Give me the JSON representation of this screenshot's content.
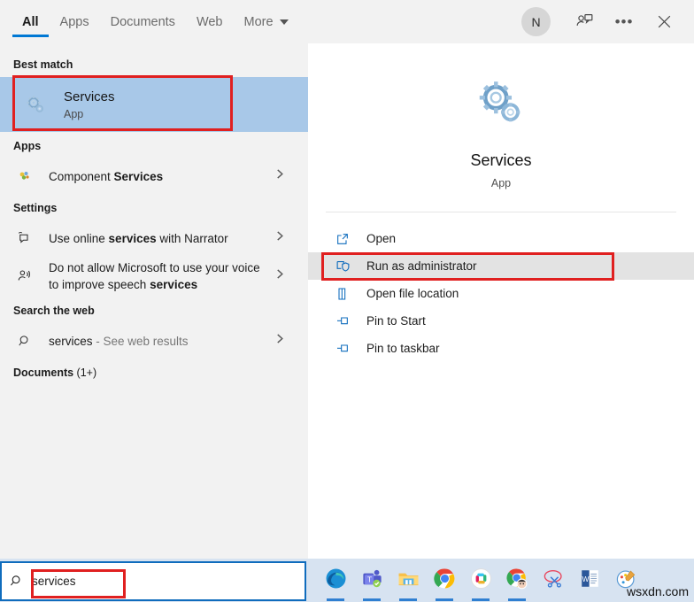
{
  "tabs": [
    {
      "label": "All",
      "active": true
    },
    {
      "label": "Apps",
      "active": false
    },
    {
      "label": "Documents",
      "active": false
    },
    {
      "label": "Web",
      "active": false
    },
    {
      "label": "More",
      "active": false,
      "caret": true
    }
  ],
  "header": {
    "avatar_initial": "N",
    "feedback_icon": "person-feedback-icon",
    "more_icon": "ellipsis-icon",
    "close_icon": "close-icon"
  },
  "left": {
    "best_match_header": "Best match",
    "best_match": {
      "title": "Services",
      "subtitle": "App",
      "icon": "services-gears-icon"
    },
    "apps_header": "Apps",
    "apps": [
      {
        "prefix": "Component ",
        "bold": "Services",
        "suffix": "",
        "icon": "component-services-icon"
      }
    ],
    "settings_header": "Settings",
    "settings": [
      {
        "prefix": "Use online ",
        "bold": "services",
        "suffix": " with Narrator",
        "icon": "narrator-icon"
      },
      {
        "prefix": "Do not allow Microsoft to use your voice to improve speech ",
        "bold": "services",
        "suffix": "",
        "icon": "voice-icon"
      }
    ],
    "web_header": "Search the web",
    "web": [
      {
        "query": "services",
        "suffix": " - See web results",
        "icon": "search-icon"
      }
    ],
    "documents_header_bold": "Documents",
    "documents_header_count": " (1+)"
  },
  "right": {
    "title": "Services",
    "subtitle": "App",
    "icon": "services-gears-icon",
    "actions": [
      {
        "label": "Open",
        "icon": "open-icon",
        "hover": false
      },
      {
        "label": "Run as administrator",
        "icon": "shield-run-icon",
        "hover": true
      },
      {
        "label": "Open file location",
        "icon": "folder-location-icon",
        "hover": false
      },
      {
        "label": "Pin to Start",
        "icon": "pin-icon",
        "hover": false
      },
      {
        "label": "Pin to taskbar",
        "icon": "pin-icon",
        "hover": false
      }
    ]
  },
  "taskbar": {
    "search_value": "services",
    "search_icon": "magnifier-icon",
    "apps": [
      {
        "name": "edge-icon",
        "running": true
      },
      {
        "name": "teams-icon",
        "running": true
      },
      {
        "name": "file-explorer-icon",
        "running": true
      },
      {
        "name": "chrome-icon",
        "running": true
      },
      {
        "name": "slack-icon",
        "running": true
      },
      {
        "name": "chrome-profile-icon",
        "running": true
      },
      {
        "name": "snipping-tool-icon",
        "running": false
      },
      {
        "name": "word-icon",
        "running": false
      },
      {
        "name": "paint-icon",
        "running": false
      }
    ]
  },
  "watermark": "wsxdn.com",
  "colors": {
    "accent": "#0078d4",
    "best_match_highlight": "#a8c8e8",
    "annotation_red": "#e02020",
    "taskbar": "#d7e3f1"
  }
}
